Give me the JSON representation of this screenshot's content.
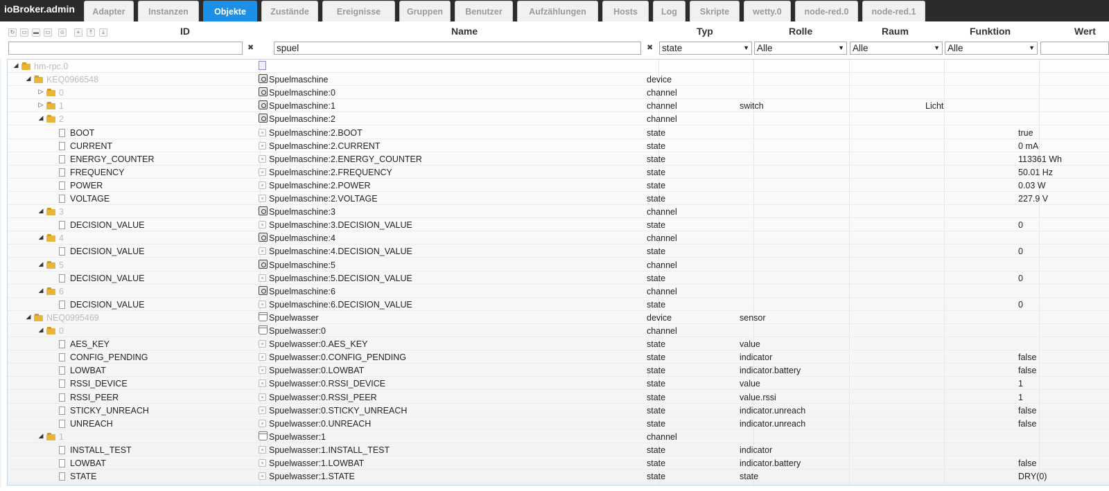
{
  "app": {
    "brand": "ioBroker.admin"
  },
  "tabs": [
    {
      "label": "Adapter",
      "active": false
    },
    {
      "label": "Instanzen",
      "active": false
    },
    {
      "label": "Objekte",
      "active": true
    },
    {
      "label": "Zustände",
      "active": false
    },
    {
      "label": "Ereignisse",
      "active": false
    },
    {
      "label": "Gruppen",
      "active": false
    },
    {
      "label": "Benutzer",
      "active": false
    },
    {
      "label": "Aufzählungen",
      "active": false
    },
    {
      "label": "Hosts",
      "active": false
    },
    {
      "label": "Log",
      "active": false
    },
    {
      "label": "Skripte",
      "active": false
    },
    {
      "label": "wetty.0",
      "active": false
    },
    {
      "label": "node-red.0",
      "active": false
    },
    {
      "label": "node-red.1",
      "active": false
    }
  ],
  "toolbar": {
    "icons": [
      "refresh-icon",
      "collapse-icon",
      "folder-closed-icon",
      "folder-open-icon",
      "user-icon",
      "add-icon",
      "upload-icon",
      "download-icon"
    ],
    "glyphs": [
      "↻",
      "▭",
      "▬",
      "▭",
      "☺",
      "+",
      "⤒",
      "⤓"
    ]
  },
  "columns": {
    "id": "ID",
    "name": "Name",
    "type": "Typ",
    "role": "Rolle",
    "room": "Raum",
    "function": "Funktion",
    "value": "Wert"
  },
  "filters": {
    "id_value": "",
    "name_value": "spuel",
    "clear_glyph": "✖",
    "type_value": "state",
    "role_value": "Alle",
    "room_value": "Alle",
    "function_value": "Alle",
    "caret": "▼",
    "value_value": ""
  },
  "rows": [
    {
      "indent": 0,
      "toggle": "◢",
      "kind": "folder",
      "id": "hm-rpc.0",
      "icon": "top",
      "name": "",
      "type": "",
      "role": "",
      "room": "",
      "func": "",
      "value": ""
    },
    {
      "indent": 1,
      "toggle": "◢",
      "kind": "folder",
      "id": "KEQ0966548",
      "icon": "device",
      "name": "Spuelmaschine",
      "type": "device",
      "role": "",
      "room": "",
      "func": "",
      "value": ""
    },
    {
      "indent": 2,
      "toggle": "▷",
      "kind": "folder",
      "id": "0",
      "icon": "device",
      "name": "Spuelmaschine:0",
      "type": "channel",
      "role": "",
      "room": "",
      "func": "",
      "value": ""
    },
    {
      "indent": 2,
      "toggle": "▷",
      "kind": "folder",
      "id": "1",
      "icon": "device",
      "name": "Spuelmaschine:1",
      "type": "channel",
      "role": "switch",
      "room": "",
      "func": "Licht",
      "value": ""
    },
    {
      "indent": 2,
      "toggle": "◢",
      "kind": "folder",
      "id": "2",
      "icon": "device",
      "name": "Spuelmaschine:2",
      "type": "channel",
      "role": "",
      "room": "",
      "func": "",
      "value": ""
    },
    {
      "indent": 3,
      "toggle": "",
      "kind": "doc",
      "id": "BOOT",
      "icon": "state",
      "name": "Spuelmaschine:2.BOOT",
      "type": "state",
      "role": "",
      "room": "",
      "func": "",
      "value": "true"
    },
    {
      "indent": 3,
      "toggle": "",
      "kind": "doc",
      "id": "CURRENT",
      "icon": "state",
      "name": "Spuelmaschine:2.CURRENT",
      "type": "state",
      "role": "",
      "room": "",
      "func": "",
      "value": "0 mA"
    },
    {
      "indent": 3,
      "toggle": "",
      "kind": "doc",
      "id": "ENERGY_COUNTER",
      "icon": "state",
      "name": "Spuelmaschine:2.ENERGY_COUNTER",
      "type": "state",
      "role": "",
      "room": "",
      "func": "",
      "value": "113361 Wh"
    },
    {
      "indent": 3,
      "toggle": "",
      "kind": "doc",
      "id": "FREQUENCY",
      "icon": "state",
      "name": "Spuelmaschine:2.FREQUENCY",
      "type": "state",
      "role": "",
      "room": "",
      "func": "",
      "value": "50.01 Hz"
    },
    {
      "indent": 3,
      "toggle": "",
      "kind": "doc",
      "id": "POWER",
      "icon": "state",
      "name": "Spuelmaschine:2.POWER",
      "type": "state",
      "role": "",
      "room": "",
      "func": "",
      "value": "0.03 W"
    },
    {
      "indent": 3,
      "toggle": "",
      "kind": "doc",
      "id": "VOLTAGE",
      "icon": "state",
      "name": "Spuelmaschine:2.VOLTAGE",
      "type": "state",
      "role": "",
      "room": "",
      "func": "",
      "value": "227.9 V"
    },
    {
      "indent": 2,
      "toggle": "◢",
      "kind": "folder",
      "id": "3",
      "icon": "device",
      "name": "Spuelmaschine:3",
      "type": "channel",
      "role": "",
      "room": "",
      "func": "",
      "value": ""
    },
    {
      "indent": 3,
      "toggle": "",
      "kind": "doc",
      "id": "DECISION_VALUE",
      "icon": "state",
      "name": "Spuelmaschine:3.DECISION_VALUE",
      "type": "state",
      "role": "",
      "room": "",
      "func": "",
      "value": "0"
    },
    {
      "indent": 2,
      "toggle": "◢",
      "kind": "folder",
      "id": "4",
      "icon": "device",
      "name": "Spuelmaschine:4",
      "type": "channel",
      "role": "",
      "room": "",
      "func": "",
      "value": ""
    },
    {
      "indent": 3,
      "toggle": "",
      "kind": "doc",
      "id": "DECISION_VALUE",
      "icon": "state",
      "name": "Spuelmaschine:4.DECISION_VALUE",
      "type": "state",
      "role": "",
      "room": "",
      "func": "",
      "value": "0"
    },
    {
      "indent": 2,
      "toggle": "◢",
      "kind": "folder",
      "id": "5",
      "icon": "device",
      "name": "Spuelmaschine:5",
      "type": "channel",
      "role": "",
      "room": "",
      "func": "",
      "value": ""
    },
    {
      "indent": 3,
      "toggle": "",
      "kind": "doc",
      "id": "DECISION_VALUE",
      "icon": "state",
      "name": "Spuelmaschine:5.DECISION_VALUE",
      "type": "state",
      "role": "",
      "room": "",
      "func": "",
      "value": "0"
    },
    {
      "indent": 2,
      "toggle": "◢",
      "kind": "folder",
      "id": "6",
      "icon": "device",
      "name": "Spuelmaschine:6",
      "type": "channel",
      "role": "",
      "room": "",
      "func": "",
      "value": ""
    },
    {
      "indent": 3,
      "toggle": "",
      "kind": "doc",
      "id": "DECISION_VALUE",
      "icon": "state",
      "name": "Spuelmaschine:6.DECISION_VALUE",
      "type": "state",
      "role": "",
      "room": "",
      "func": "",
      "value": "0"
    },
    {
      "indent": 1,
      "toggle": "◢",
      "kind": "folder",
      "id": "NEQ0995469",
      "icon": "water",
      "name": "Spuelwasser",
      "type": "device",
      "role": "sensor",
      "room": "",
      "func": "",
      "value": ""
    },
    {
      "indent": 2,
      "toggle": "◢",
      "kind": "folder",
      "id": "0",
      "icon": "water",
      "name": "Spuelwasser:0",
      "type": "channel",
      "role": "",
      "room": "",
      "func": "",
      "value": ""
    },
    {
      "indent": 3,
      "toggle": "",
      "kind": "doc",
      "id": "AES_KEY",
      "icon": "state",
      "name": "Spuelwasser:0.AES_KEY",
      "type": "state",
      "role": "value",
      "room": "",
      "func": "",
      "value": ""
    },
    {
      "indent": 3,
      "toggle": "",
      "kind": "doc",
      "id": "CONFIG_PENDING",
      "icon": "state",
      "name": "Spuelwasser:0.CONFIG_PENDING",
      "type": "state",
      "role": "indicator",
      "room": "",
      "func": "",
      "value": "false"
    },
    {
      "indent": 3,
      "toggle": "",
      "kind": "doc",
      "id": "LOWBAT",
      "icon": "state",
      "name": "Spuelwasser:0.LOWBAT",
      "type": "state",
      "role": "indicator.battery",
      "room": "",
      "func": "",
      "value": "false"
    },
    {
      "indent": 3,
      "toggle": "",
      "kind": "doc",
      "id": "RSSI_DEVICE",
      "icon": "state",
      "name": "Spuelwasser:0.RSSI_DEVICE",
      "type": "state",
      "role": "value",
      "room": "",
      "func": "",
      "value": "1"
    },
    {
      "indent": 3,
      "toggle": "",
      "kind": "doc",
      "id": "RSSI_PEER",
      "icon": "state",
      "name": "Spuelwasser:0.RSSI_PEER",
      "type": "state",
      "role": "value.rssi",
      "room": "",
      "func": "",
      "value": "1"
    },
    {
      "indent": 3,
      "toggle": "",
      "kind": "doc",
      "id": "STICKY_UNREACH",
      "icon": "state",
      "name": "Spuelwasser:0.STICKY_UNREACH",
      "type": "state",
      "role": "indicator.unreach",
      "room": "",
      "func": "",
      "value": "false"
    },
    {
      "indent": 3,
      "toggle": "",
      "kind": "doc",
      "id": "UNREACH",
      "icon": "state",
      "name": "Spuelwasser:0.UNREACH",
      "type": "state",
      "role": "indicator.unreach",
      "room": "",
      "func": "",
      "value": "false"
    },
    {
      "indent": 2,
      "toggle": "◢",
      "kind": "folder",
      "id": "1",
      "icon": "water",
      "name": "Spuelwasser:1",
      "type": "channel",
      "role": "",
      "room": "",
      "func": "",
      "value": ""
    },
    {
      "indent": 3,
      "toggle": "",
      "kind": "doc",
      "id": "INSTALL_TEST",
      "icon": "state",
      "name": "Spuelwasser:1.INSTALL_TEST",
      "type": "state",
      "role": "indicator",
      "room": "",
      "func": "",
      "value": ""
    },
    {
      "indent": 3,
      "toggle": "",
      "kind": "doc",
      "id": "LOWBAT",
      "icon": "state",
      "name": "Spuelwasser:1.LOWBAT",
      "type": "state",
      "role": "indicator.battery",
      "room": "",
      "func": "",
      "value": "false"
    },
    {
      "indent": 3,
      "toggle": "",
      "kind": "doc",
      "id": "STATE",
      "icon": "state",
      "name": "Spuelwasser:1.STATE",
      "type": "state",
      "role": "state",
      "room": "",
      "func": "",
      "value": "DRY(0)"
    }
  ]
}
